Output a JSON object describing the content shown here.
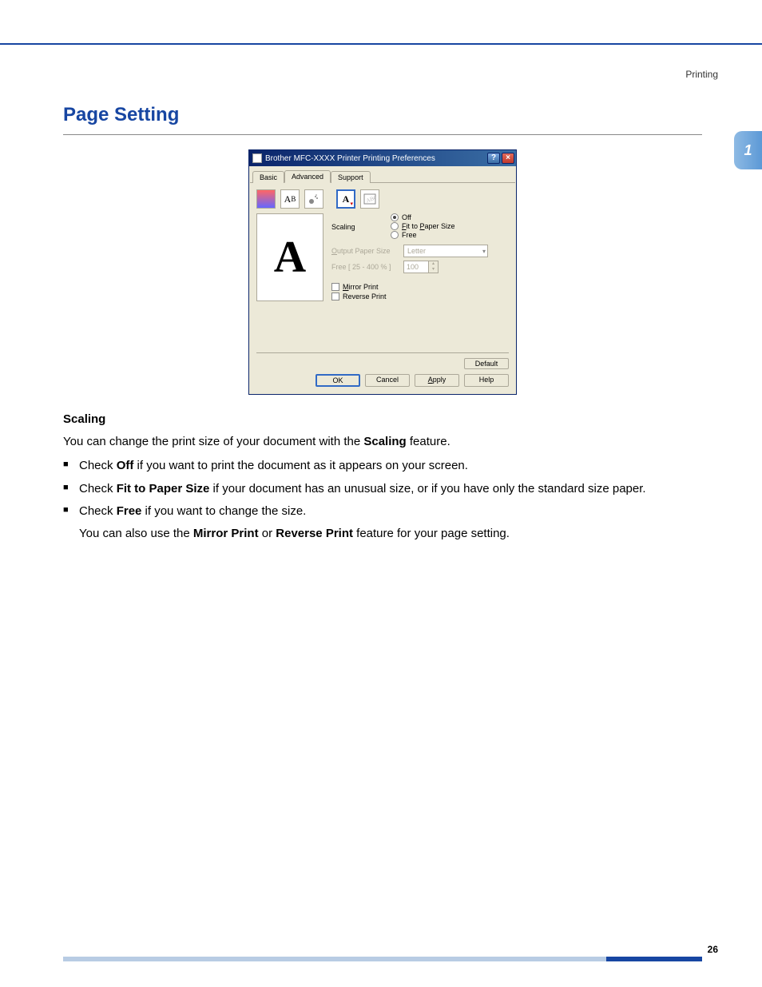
{
  "header": {
    "section_label": "Printing"
  },
  "chapter_tab": "1",
  "title": "Page Setting",
  "dialog": {
    "title": "Brother MFC-XXXX Printer Printing Preferences",
    "help_btn": "?",
    "close_btn": "×",
    "tabs": [
      "Basic",
      "Advanced",
      "Support"
    ],
    "active_tab_index": 1,
    "toolbar_icons": [
      "page-color-icon",
      "text-ab-icon",
      "spray-icon",
      "page-a-icon",
      "watermark-icon"
    ],
    "preview_glyph": "A",
    "opts": {
      "scaling_label": "Scaling",
      "scaling_options": [
        "Off",
        "Fit to Paper Size",
        "Free"
      ],
      "scaling_selected_index": 0,
      "output_paper_label": "Output Paper Size",
      "output_paper_value": "Letter",
      "free_label": "Free [ 25 - 400 % ]",
      "free_value": "100",
      "mirror_label": "Mirror Print",
      "reverse_label": "Reverse Print"
    },
    "buttons": {
      "default": "Default",
      "ok": "OK",
      "cancel": "Cancel",
      "apply": "Apply",
      "help": "Help"
    }
  },
  "body": {
    "scaling_heading": "Scaling",
    "intro_a": "You can change the print size of your document with the ",
    "intro_bold": "Scaling",
    "intro_b": " feature.",
    "bullet1_a": "Check ",
    "bullet1_bold": "Off",
    "bullet1_b": " if you want to print the document as it appears on your screen.",
    "bullet2_a": "Check ",
    "bullet2_bold": "Fit to Paper Size",
    "bullet2_b": " if your document has an unusual size, or if you have only the standard size paper.",
    "bullet3_a": "Check ",
    "bullet3_bold": "Free",
    "bullet3_b": " if you want to change the size.",
    "sub_a": "You can also use the ",
    "sub_bold1": "Mirror Print",
    "sub_mid": " or ",
    "sub_bold2": "Reverse Print",
    "sub_b": " feature for your page setting."
  },
  "page_number": "26"
}
